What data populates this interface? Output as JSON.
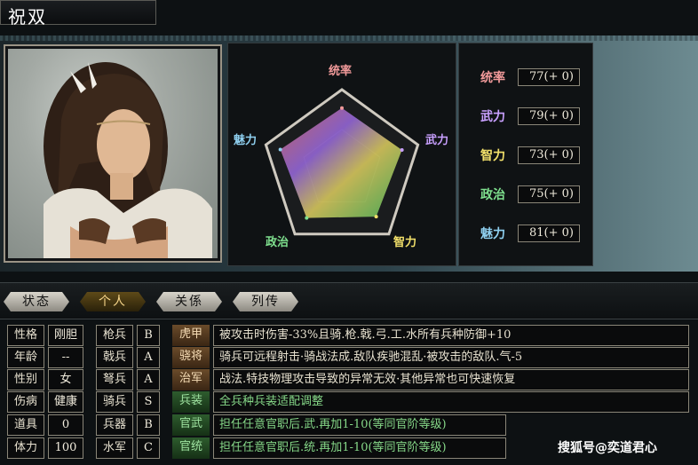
{
  "header": {
    "name": "祝双"
  },
  "radar": {
    "labels": [
      "统率",
      "武力",
      "智力",
      "政治",
      "魅力"
    ],
    "colors": [
      "#f19a9a",
      "#c9a0ff",
      "#f2e06a",
      "#7fe08e",
      "#8fd0f0"
    ],
    "values": [
      77,
      79,
      73,
      75,
      81
    ],
    "max": 100
  },
  "stats": [
    {
      "label": "统率",
      "value": "77(+ 0)",
      "color": "#f19a9a"
    },
    {
      "label": "武力",
      "value": "79(+ 0)",
      "color": "#c9a0ff"
    },
    {
      "label": "智力",
      "value": "73(+ 0)",
      "color": "#f2e06a"
    },
    {
      "label": "政治",
      "value": "75(+ 0)",
      "color": "#7fe08e"
    },
    {
      "label": "魅力",
      "value": "81(+ 0)",
      "color": "#8fd0f0"
    }
  ],
  "tabs": [
    "状态",
    "个人",
    "关係",
    "列传"
  ],
  "personal": [
    {
      "label": "性格",
      "value": "刚胆"
    },
    {
      "label": "年龄",
      "value": "--"
    },
    {
      "label": "性别",
      "value": "女"
    },
    {
      "label": "伤病",
      "value": "健康"
    },
    {
      "label": "道具",
      "value": "0"
    },
    {
      "label": "体力",
      "value": "100"
    }
  ],
  "aptitudes": [
    {
      "label": "枪兵",
      "value": "B"
    },
    {
      "label": "戟兵",
      "value": "A"
    },
    {
      "label": "弩兵",
      "value": "A"
    },
    {
      "label": "骑兵",
      "value": "S"
    },
    {
      "label": "兵器",
      "value": "B"
    },
    {
      "label": "水军",
      "value": "C"
    }
  ],
  "skills": [
    {
      "name": "虎甲",
      "desc": "被攻击时伤害-33%且骑.枪.戟.弓.工.水所有兵种防御+10",
      "green": false
    },
    {
      "name": "骁将",
      "desc": "骑兵可远程射击·骑战法成.敌队疾驰混乱·被攻击的敌队.气-5",
      "green": false
    },
    {
      "name": "治军",
      "desc": "战法.特技物理攻击导致的异常无效·其他异常也可快速恢复",
      "green": false
    },
    {
      "name": "兵装",
      "desc": "全兵种兵装适配调整",
      "green": true
    },
    {
      "name": "官武",
      "desc": "担任任意官职后.武.再加1-10(等同官阶等级)",
      "green": true
    },
    {
      "name": "官统",
      "desc": "担任任意官职后.统.再加1-10(等同官阶等级)",
      "green": true
    }
  ],
  "watermark": "搜狐号@奕道君心"
}
